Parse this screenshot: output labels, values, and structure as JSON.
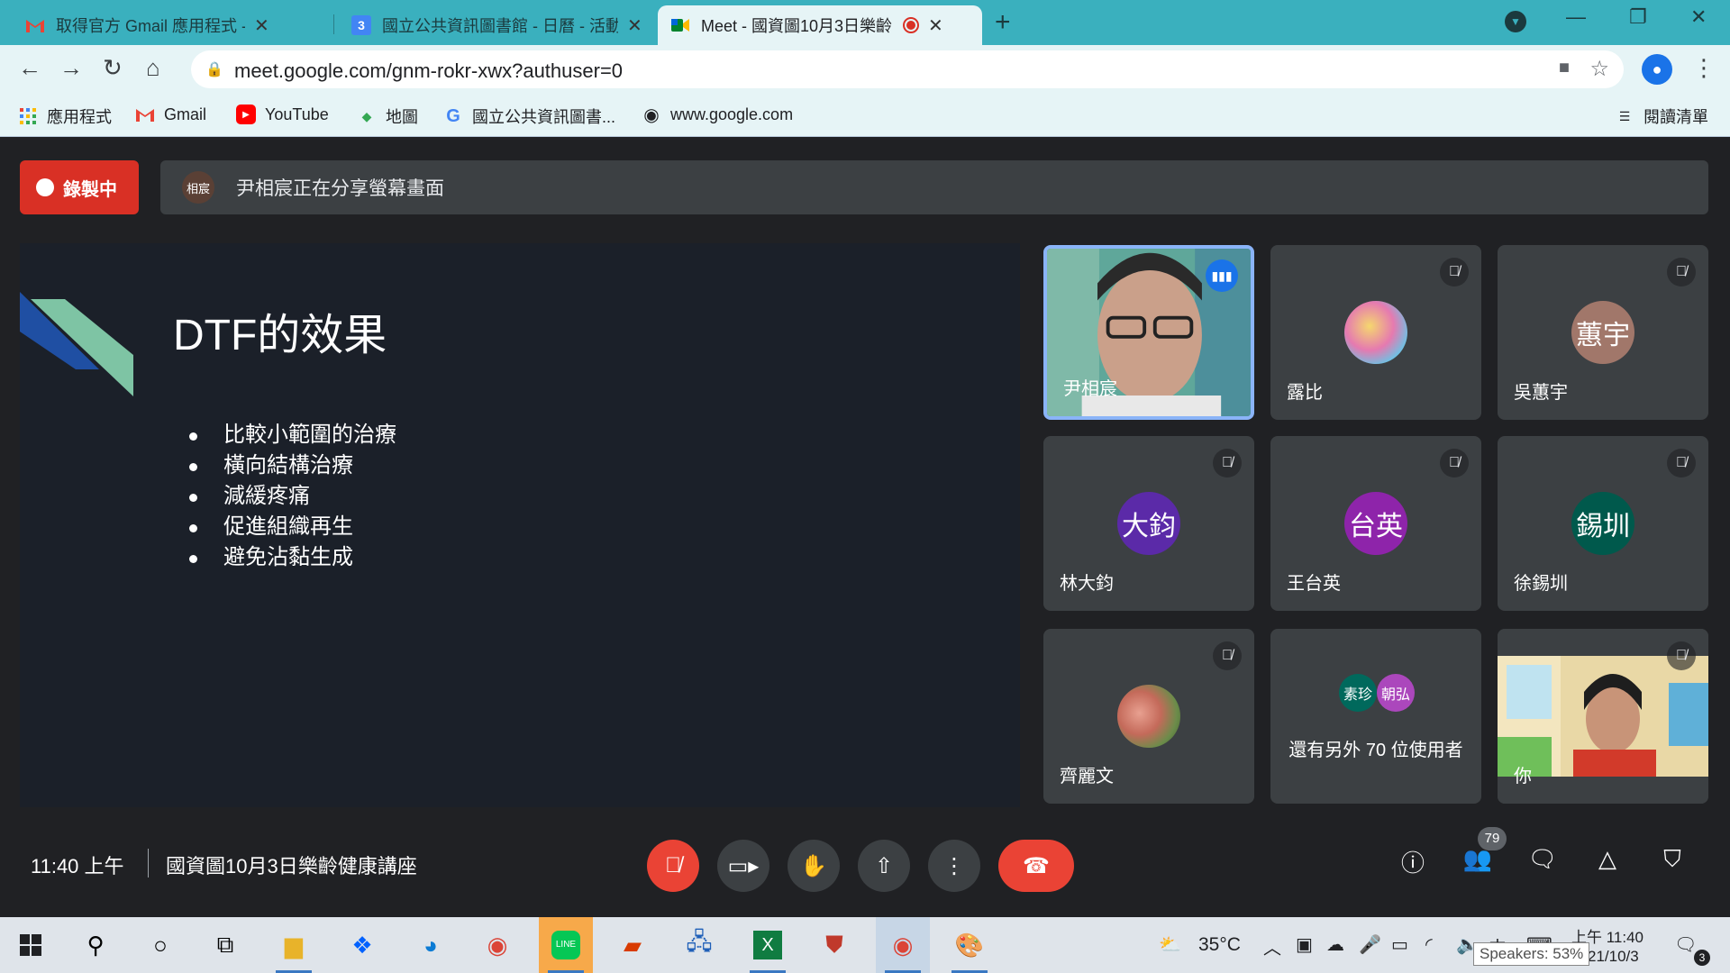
{
  "browser": {
    "tabs": [
      {
        "title": "取得官方 Gmail 應用程式 - mcc(",
        "icon": "gmail-icon"
      },
      {
        "title": "國立公共資訊圖書館 - 日曆 - 活動",
        "icon": "calendar-icon",
        "icon_text": "3"
      },
      {
        "title": "Meet - 國資圖10月3日樂齡",
        "icon": "meet-icon"
      }
    ],
    "url": "meet.google.com/gnm-rokr-xwx?authuser=0",
    "bookmarks": [
      {
        "label": "應用程式",
        "icon": "apps-grid-icon"
      },
      {
        "label": "Gmail",
        "icon": "gmail-icon"
      },
      {
        "label": "YouTube",
        "icon": "youtube-icon"
      },
      {
        "label": "地圖",
        "icon": "maps-icon"
      },
      {
        "label": "國立公共資訊圖書...",
        "icon": "google-icon"
      },
      {
        "label": "www.google.com",
        "icon": "globe-icon"
      }
    ],
    "reading_list": "閱讀清單"
  },
  "meet": {
    "recording_label": "錄製中",
    "presenter_avatar": "相宸",
    "share_banner": "尹相宸正在分享螢幕畫面",
    "slide": {
      "title": "DTF的效果",
      "bullets": [
        "比較小範圍的治療",
        "橫向結構治療",
        "減緩疼痛",
        "促進組織再生",
        "避免沾黏生成"
      ]
    },
    "participants": [
      {
        "name": "尹相宸",
        "type": "video",
        "speaking": true
      },
      {
        "name": "露比",
        "type": "photo",
        "muted": true
      },
      {
        "name": "吳蕙宇",
        "avatar": "蕙宇",
        "color": "#a1776a",
        "muted": true
      },
      {
        "name": "林大鈞",
        "avatar": "大鈞",
        "color": "#5b2aa8",
        "muted": true
      },
      {
        "name": "王台英",
        "avatar": "台英",
        "color": "#8e24aa",
        "muted": true
      },
      {
        "name": "徐錫圳",
        "avatar": "錫圳",
        "color": "#00594c",
        "muted": true
      },
      {
        "name": "齊麗文",
        "type": "photo",
        "muted": true
      },
      {
        "more_label": "還有另外 70 位使用者",
        "avatars": [
          {
            "text": "素珍",
            "color": "#00695c"
          },
          {
            "text": "朝弘",
            "color": "#ab47bc"
          }
        ]
      },
      {
        "name": "你",
        "type": "video",
        "muted": true
      }
    ],
    "clock": "11:40 上午",
    "meeting_name": "國資圖10月3日樂齡健康講座",
    "people_count": "79"
  },
  "taskbar": {
    "temperature": "35°C",
    "time": "上午 11:40",
    "date": "21/10/3",
    "ime": "中",
    "speaker_tooltip": "Speakers: 53%",
    "notifications": "3"
  }
}
